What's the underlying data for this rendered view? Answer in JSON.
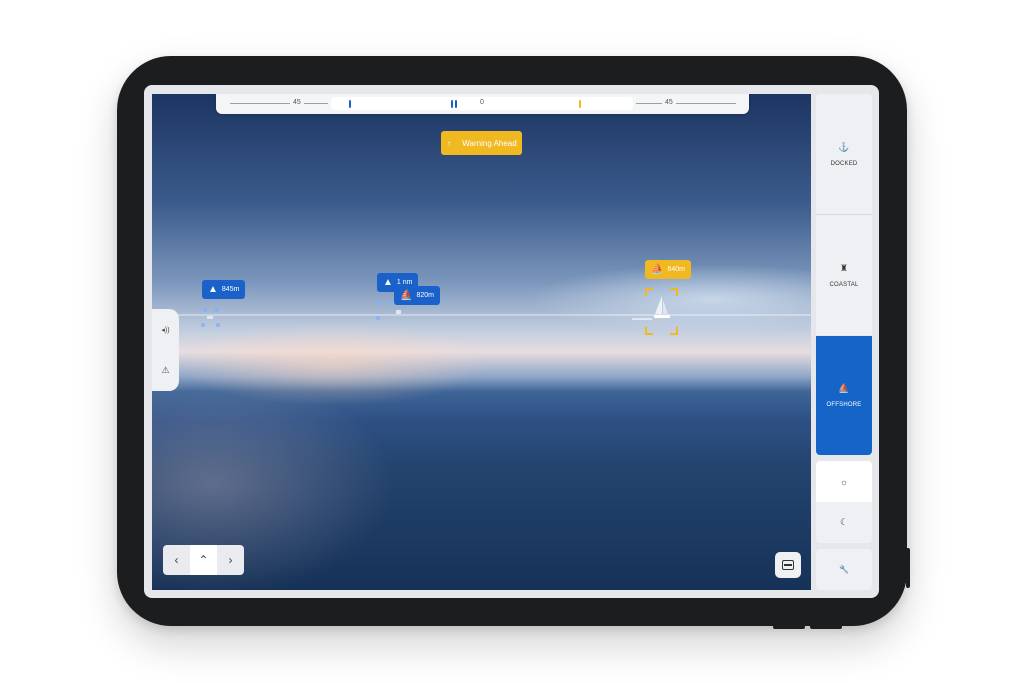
{
  "compass": {
    "left_label": "45",
    "center_label": "0",
    "right_label": "45"
  },
  "warning": {
    "icon": "arrow-up-icon",
    "label": "Warning Ahead"
  },
  "targets": [
    {
      "label": "845m",
      "color": "#1a62c9",
      "icon": "warning-triangle-icon"
    },
    {
      "label": "1 nm",
      "color": "#1a62c9",
      "icon": "warning-triangle-icon"
    },
    {
      "label": "820m",
      "color": "#1a62c9",
      "icon": "sailboat-icon"
    },
    {
      "label": "640m",
      "color": "#f0b922",
      "icon": "sailboat-icon"
    }
  ],
  "left_tools": [
    {
      "icon": "volume-icon",
      "glyph": "◂))"
    },
    {
      "icon": "alert-icon",
      "glyph": "⚠"
    }
  ],
  "nav": {
    "prev": "‹",
    "up": "⌃",
    "next": "›"
  },
  "modes": [
    {
      "label": "DOCKED",
      "icon": "anchor-icon",
      "glyph": "⚓",
      "active": false
    },
    {
      "label": "COASTAL",
      "icon": "lighthouse-icon",
      "glyph": "♜",
      "active": false
    },
    {
      "label": "OFFSHORE",
      "icon": "sailboat-icon",
      "glyph": "⛵",
      "active": true
    }
  ],
  "theme": {
    "light_glyph": "☼",
    "dark_glyph": "☾"
  },
  "settings_glyph": "🔧",
  "colors": {
    "accent_blue": "#1565c9",
    "warning_yellow": "#f0b922",
    "panel_bg": "#eef0f3"
  }
}
